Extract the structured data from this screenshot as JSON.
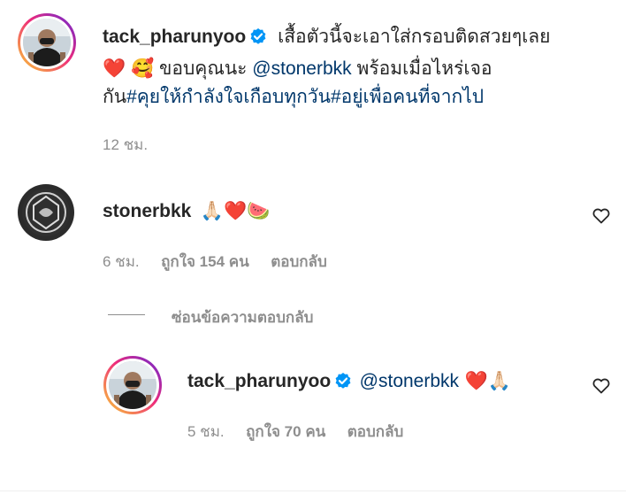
{
  "caption": {
    "username": "tack_pharunyoo",
    "text_line1": "เสื้อตัวนี้จะเอาใส่กรอบติดสวยๆเลย",
    "emoji_heart": "❤️",
    "emoji_face": "🥰",
    "text_line2_pre": " ขอบคุณนะ ",
    "mention": "@stonerbkk",
    "text_line2_post": " พร้อมเมื่อไหร่เจอ",
    "text_line3_pre": "กัน",
    "hashtag1": "#คุยให้กำลังใจเกือบทุกวัน",
    "hashtag2": "#อยู่เพื่อคนที่จากไป",
    "time": "12 ชม."
  },
  "comment1": {
    "username": "stonerbkk",
    "emojis": "🙏🏻❤️🍉",
    "time": "6 ชม.",
    "likes": "ถูกใจ 154 คน",
    "reply": "ตอบกลับ",
    "hide_replies": "ซ่อนข้อความตอบกลับ"
  },
  "reply1": {
    "username": "tack_pharunyoo",
    "mention": "@stonerbkk",
    "emojis": " ❤️🙏🏻",
    "time": "5 ชม.",
    "likes": "ถูกใจ 70 คน",
    "reply": "ตอบกลับ"
  },
  "colors": {
    "text": "#262626",
    "secondary": "#8e8e8e",
    "link": "#00376b",
    "verified": "#0095f6"
  }
}
